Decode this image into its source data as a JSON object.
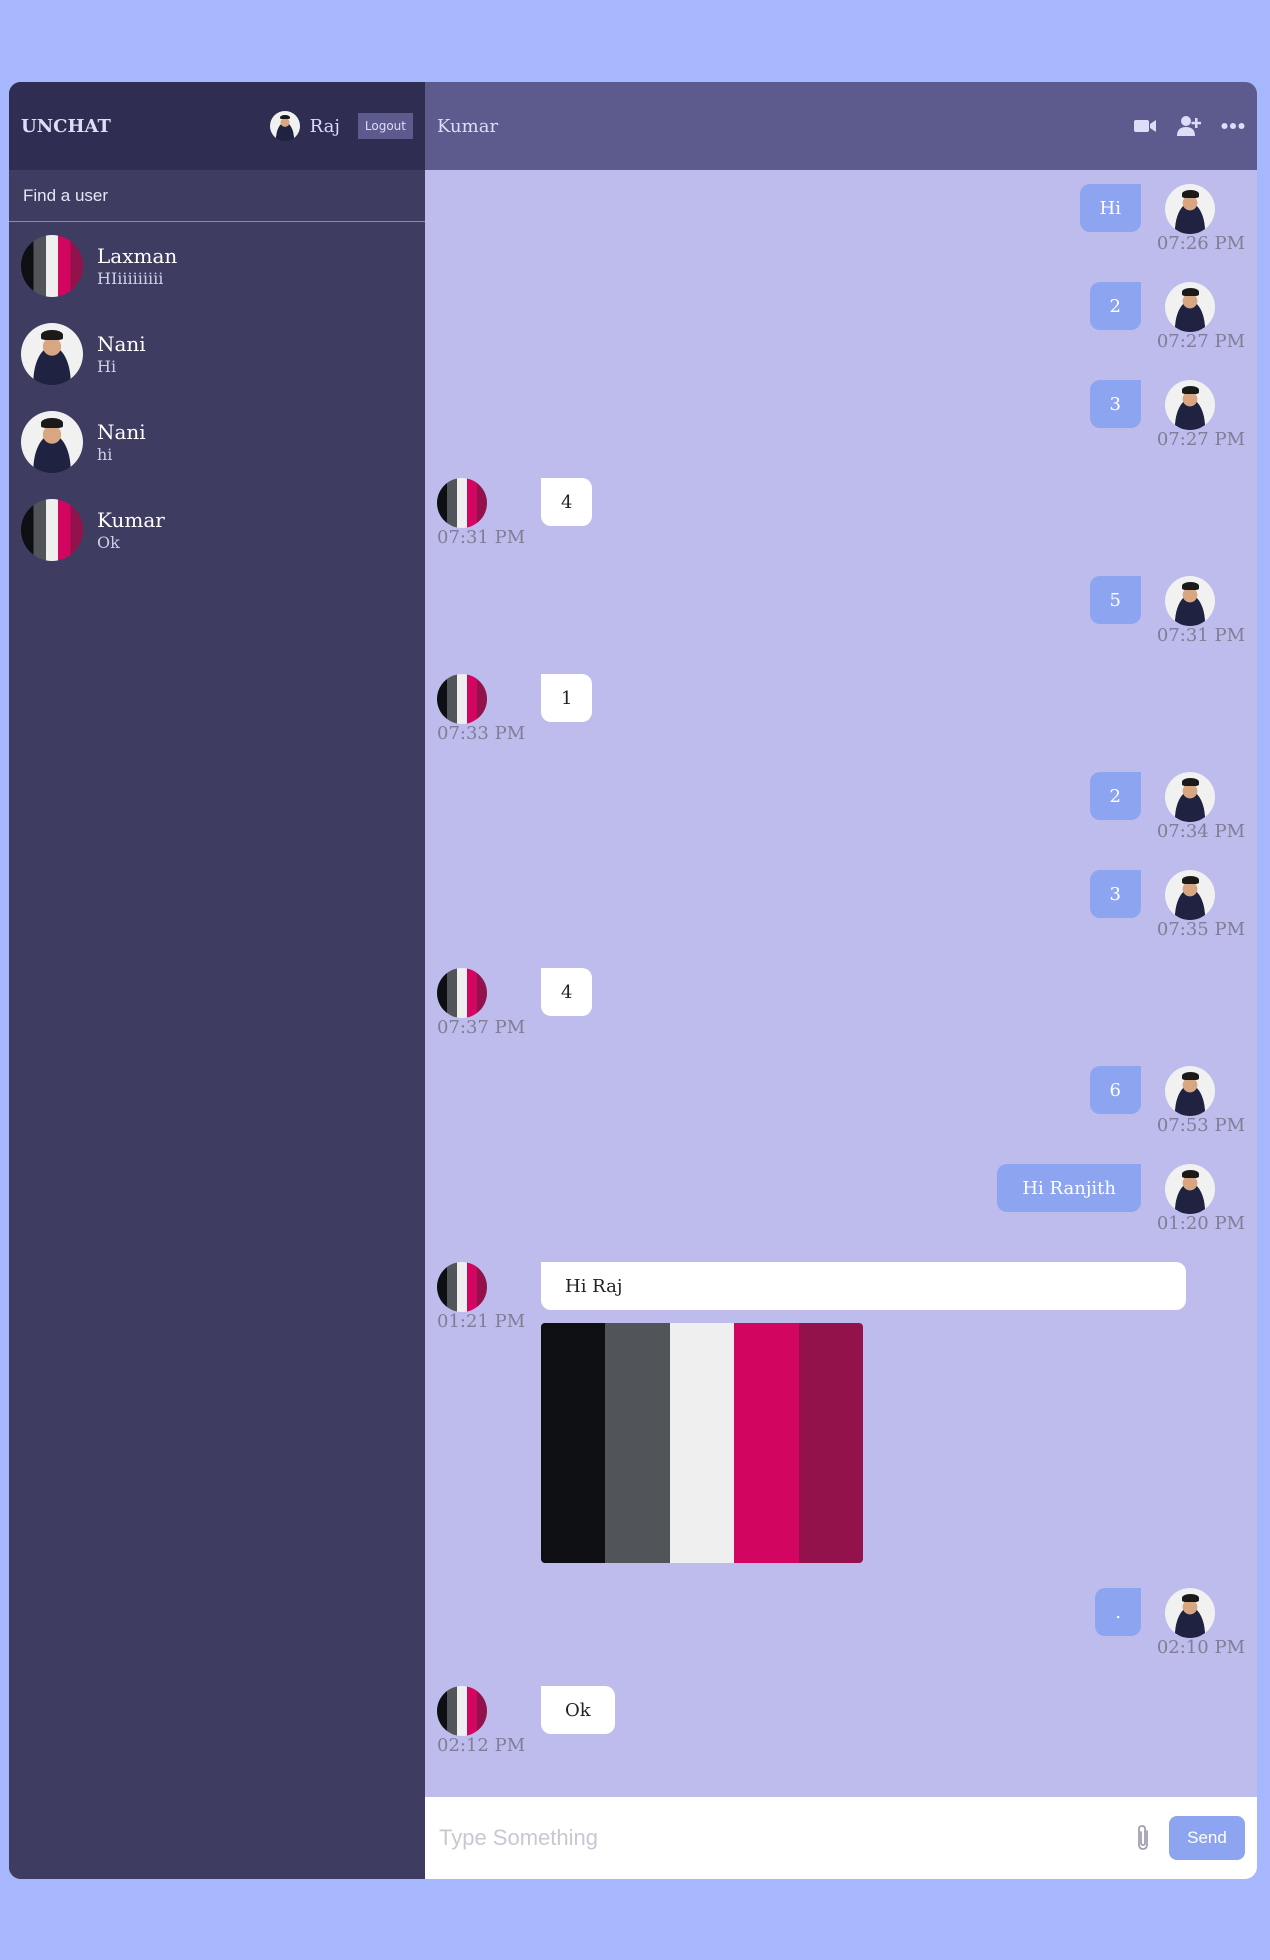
{
  "sidebar": {
    "logo": "UNCHAT",
    "user_name": "Raj",
    "logout_label": "Logout",
    "search_placeholder": "Find a user",
    "chats": [
      {
        "name": "Laxman",
        "last": "HIiiiiiiiii",
        "avatar": "flag"
      },
      {
        "name": "Nani",
        "last": "Hi",
        "avatar": "person"
      },
      {
        "name": "Nani",
        "last": "hi",
        "avatar": "person"
      },
      {
        "name": "Kumar",
        "last": "Ok",
        "avatar": "flag"
      }
    ]
  },
  "chat": {
    "title": "Kumar",
    "icons": [
      "video-camera-icon",
      "add-user-icon",
      "more-options-icon"
    ],
    "messages": [
      {
        "owner": "me",
        "text": "Hi",
        "time": "07:26 PM"
      },
      {
        "owner": "me",
        "text": "2",
        "time": "07:27 PM"
      },
      {
        "owner": "me",
        "text": "3",
        "time": "07:27 PM"
      },
      {
        "owner": "them",
        "text": "4",
        "time": "07:31 PM"
      },
      {
        "owner": "me",
        "text": "5",
        "time": "07:31 PM"
      },
      {
        "owner": "them",
        "text": "1",
        "time": "07:33 PM"
      },
      {
        "owner": "me",
        "text": "2",
        "time": "07:34 PM"
      },
      {
        "owner": "me",
        "text": "3",
        "time": "07:35 PM"
      },
      {
        "owner": "them",
        "text": "4",
        "time": "07:37 PM"
      },
      {
        "owner": "me",
        "text": "6",
        "time": "07:53 PM"
      },
      {
        "owner": "me",
        "text": "Hi Ranjith",
        "time": "01:20 PM"
      },
      {
        "owner": "them",
        "text": "Hi Raj",
        "time": "01:21 PM",
        "image_colors": [
          "#0e0f12",
          "#515459",
          "#efefef",
          "#d20660",
          "#93124b"
        ]
      },
      {
        "owner": "me",
        "text": ".",
        "time": "02:10 PM"
      },
      {
        "owner": "them",
        "text": "Ok",
        "time": "02:12 PM"
      }
    ],
    "input_placeholder": "Type Something",
    "send_label": "Send"
  },
  "colors": {
    "page_bg": "#a7b7fe",
    "sidebar_bg": "#3e3c61",
    "sidebar_header_bg": "#2f2d52",
    "chat_header_bg": "#5d5b8d",
    "messages_bg": "#bdbcec",
    "my_bubble": "#8da4f1",
    "their_bubble": "#ffffff"
  }
}
